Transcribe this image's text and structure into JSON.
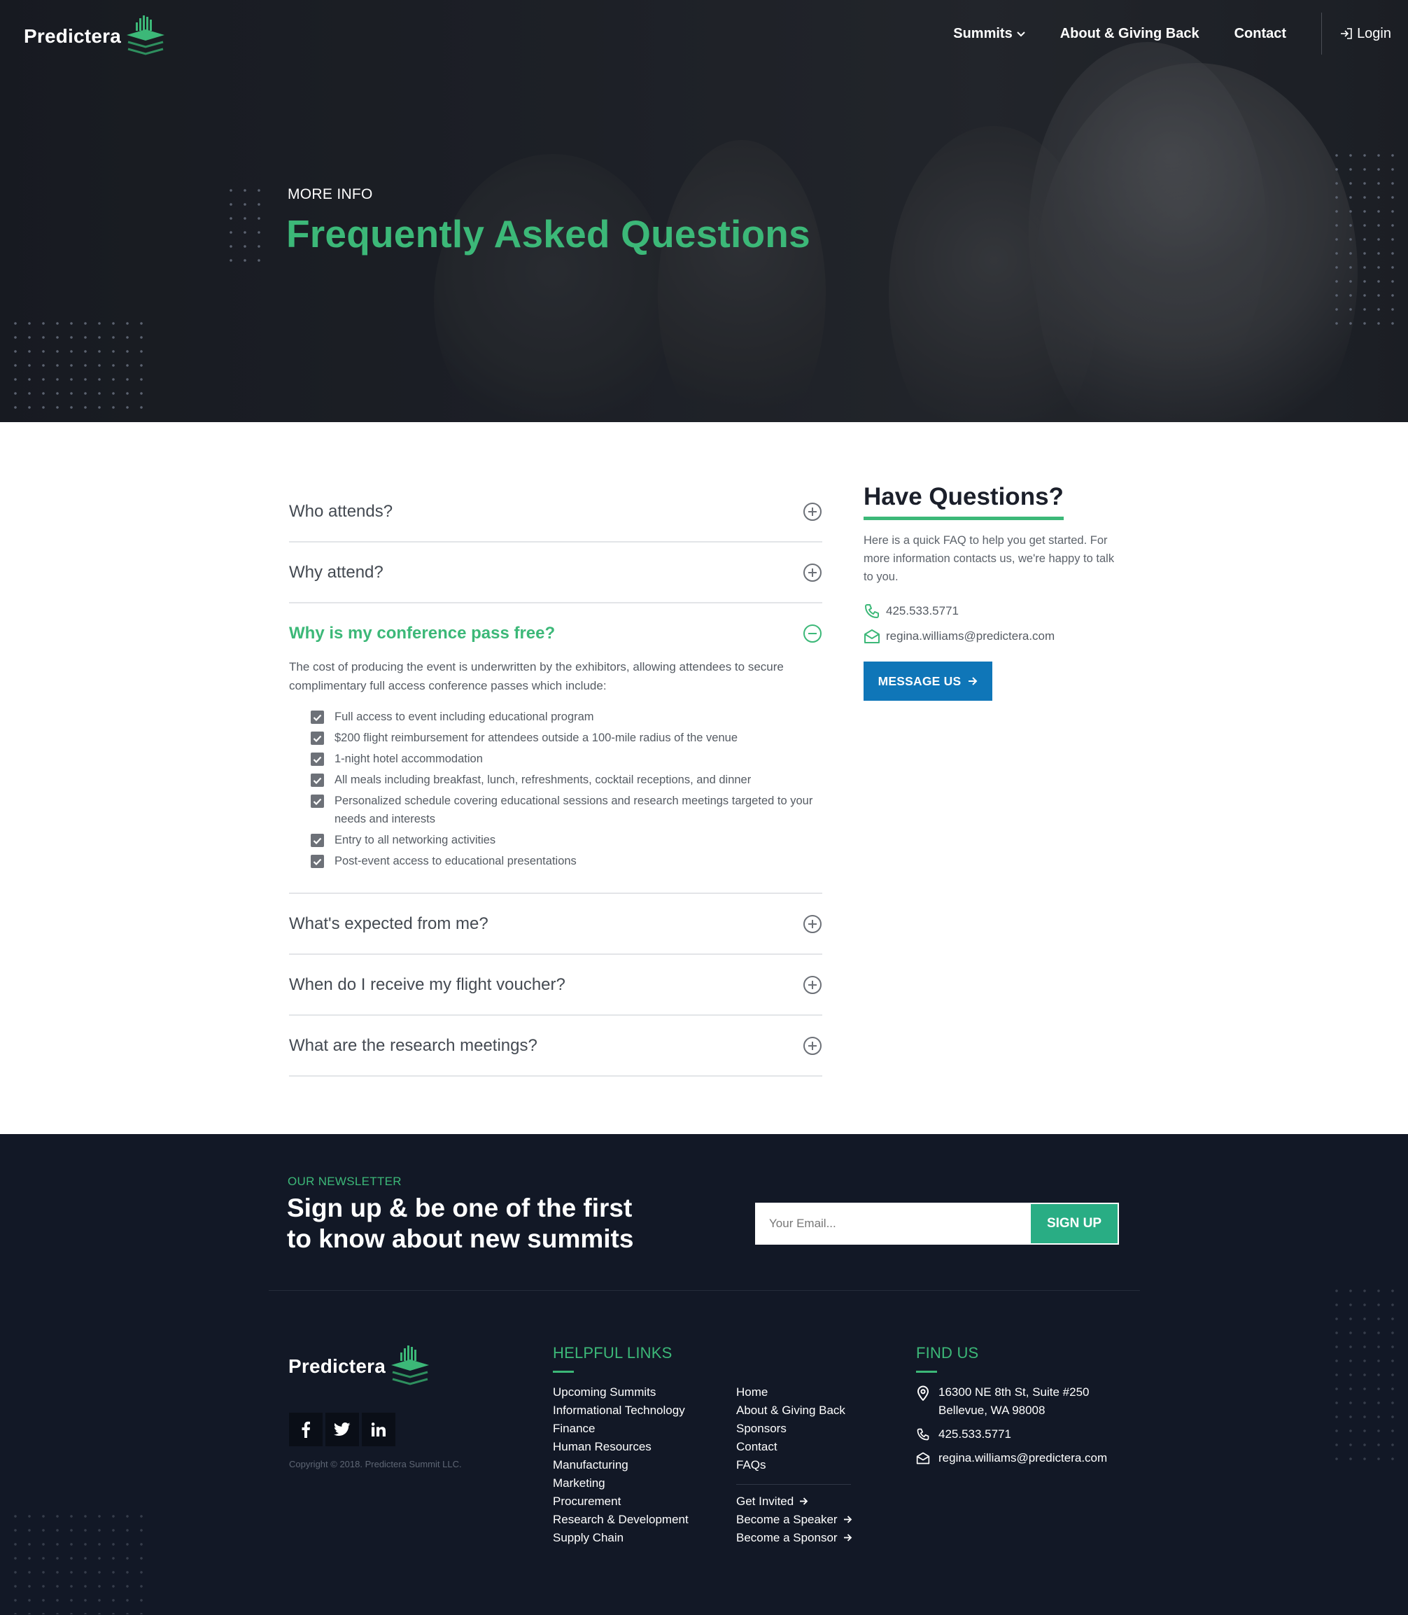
{
  "brand": {
    "name": "Predictera",
    "logo_icon": "bars-stack-logo-icon"
  },
  "nav": {
    "items": [
      {
        "label": "Summits",
        "has_dropdown": true
      },
      {
        "label": "About & Giving Back"
      },
      {
        "label": "Contact"
      }
    ],
    "login_label": "Login"
  },
  "hero": {
    "kicker": "MORE INFO",
    "title": "Frequently Asked Questions"
  },
  "faq": {
    "items": [
      {
        "question": "Who attends?",
        "open": false
      },
      {
        "question": "Why attend?",
        "open": false
      },
      {
        "question": "Why is my conference pass free?",
        "open": true,
        "answer": "The cost of producing the event is underwritten by the exhibitors, allowing attendees to secure complimentary full access conference passes which include:",
        "checklist": [
          "Full access to event including educational program",
          "$200 flight reimbursement for attendees outside a 100-mile radius of the venue",
          "1-night hotel accommodation",
          "All meals including breakfast, lunch, refreshments, cocktail receptions, and dinner",
          "Personalized schedule covering educational sessions and research meetings targeted to your needs and interests",
          "Entry to all networking activities",
          "Post-event access to educational presentations"
        ]
      },
      {
        "question": "What's expected from me?",
        "open": false
      },
      {
        "question": "When do I receive my flight voucher?",
        "open": false
      },
      {
        "question": "What are the research meetings?",
        "open": false
      }
    ]
  },
  "sidebar": {
    "title": "Have Questions?",
    "intro": "Here is a quick FAQ to help you get started. For more information contacts us, we're happy to talk to you.",
    "phone": "425.533.5771",
    "email": "regina.williams@predictera.com",
    "button_label": "MESSAGE US"
  },
  "newsletter": {
    "kicker": "OUR NEWSLETTER",
    "title_line1": "Sign up & be one of the first",
    "title_line2": "to know about new summits",
    "email_placeholder": "Your Email...",
    "button_label": "SIGN UP"
  },
  "footer": {
    "copyright": "Copyright © 2018. Predictera Summit LLC.",
    "social": [
      "facebook-icon",
      "twitter-icon",
      "linkedin-icon"
    ],
    "helpful_links_title": "HELPFUL LINKS",
    "links_col1": [
      "Upcoming Summits",
      "Informational Technology",
      "Finance",
      "Human Resources",
      "Manufacturing",
      "Marketing",
      "Procurement",
      "Research & Development",
      "Supply Chain"
    ],
    "links_col2": [
      "Home",
      "About & Giving Back",
      "Sponsors",
      "Contact",
      "FAQs"
    ],
    "links_col3": [
      "Get Invited",
      "Become a Speaker",
      "Become a Sponsor"
    ],
    "find_us_title": "FIND US",
    "address_line1": "16300 NE 8th St, Suite #250",
    "address_line2": "Bellevue, WA 98008",
    "phone": "425.533.5771",
    "email": "regina.williams@predictera.com"
  },
  "colors": {
    "accent_green": "#3cb878",
    "button_blue": "#0f76b8",
    "signup_green": "#29ad84",
    "footer_bg": "#121826"
  }
}
